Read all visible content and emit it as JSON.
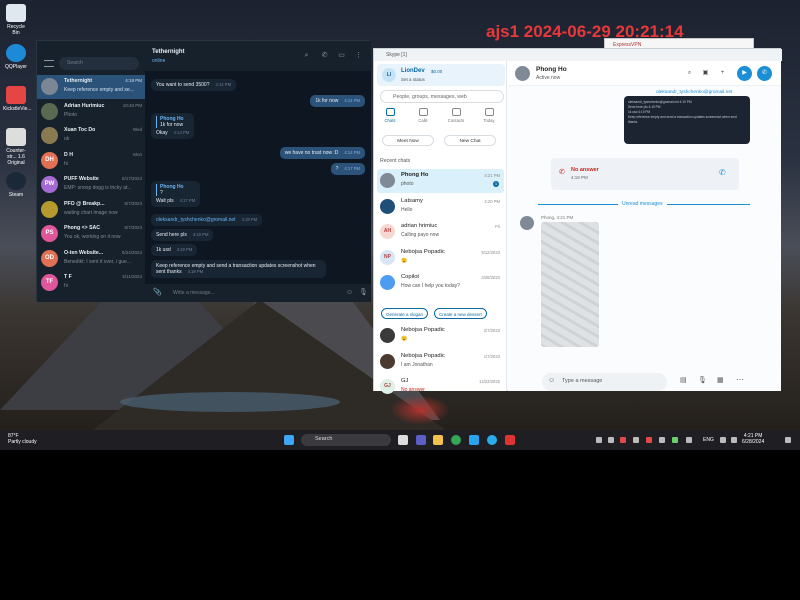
{
  "overlay_title": "ajs1 2024-06-29 20:21:14",
  "desktop_icons": [
    "Recycle Bin",
    "QQPlayer",
    "KickstleVie...",
    "Counter-str... 1.6 Original",
    "Steam"
  ],
  "telegram": {
    "search_placeholder": "Search",
    "chats": [
      {
        "initials": "",
        "name": "Tethernight",
        "time": "4:19 PM",
        "preview": "Keep reference empty and se...",
        "color": "#7b8794"
      },
      {
        "initials": "",
        "name": "Adrian Hurimiuc",
        "time": "10:40 PM",
        "preview": "Photo",
        "color": "#5a6a52"
      },
      {
        "initials": "",
        "name": "Xuan Toc Do",
        "time": "Wed",
        "preview": "ok",
        "color": "#8a7a50"
      },
      {
        "initials": "DH",
        "name": "D H",
        "time": "Mon",
        "preview": "hi",
        "color": "#e17055"
      },
      {
        "initials": "PW",
        "name": "PUFF Website",
        "time": "6/17/2024",
        "preview": "EMP: snoop dogg is tricky at...",
        "color": "#a66bd3"
      },
      {
        "initials": "",
        "name": "PFO @ Breakp...",
        "time": "6/7/2024",
        "preview": "waiting chart image now",
        "color": "#b59a2d"
      },
      {
        "initials": "PS",
        "name": "Phong <> SAC",
        "time": "6/7/2024",
        "preview": "You ok, working on it now",
        "color": "#e0569a"
      },
      {
        "initials": "OD",
        "name": "O-ten Website...",
        "time": "5/24/2024",
        "preview": "Benedikt: I sent it over, i gue...",
        "color": "#e17055"
      },
      {
        "initials": "TF",
        "name": "T F",
        "time": "5/11/2024",
        "preview": "hi",
        "color": "#e0569a"
      }
    ],
    "header": {
      "name": "Tethernight",
      "status": "online"
    },
    "messages": [
      {
        "dir": "in",
        "quote": "",
        "quote_text": "",
        "text": "You want to send 3500?",
        "time": "4:14 PM"
      },
      {
        "dir": "out",
        "quote": "",
        "quote_text": "",
        "text": "1k for now",
        "time": "4:14 PM"
      },
      {
        "dir": "in",
        "quote": "Phong Ho",
        "quote_text": "1k for now",
        "text": "Okay",
        "time": "4:14 PM"
      },
      {
        "dir": "out",
        "quote": "",
        "quote_text": "",
        "text": "we have no trust now :D",
        "time": "4:14 PM"
      },
      {
        "dir": "out",
        "quote": "",
        "quote_text": "",
        "text": "?",
        "time": "4:17 PM"
      },
      {
        "dir": "in",
        "quote": "Phong Ho",
        "quote_text": "?",
        "text": "Wait pls",
        "time": "4:17 PM"
      },
      {
        "dir": "in",
        "quote": "",
        "quote_text": "",
        "text": "oleksandr_tyshchenko@gromail.net",
        "time": "4:19 PM"
      },
      {
        "dir": "in",
        "quote": "",
        "quote_text": "",
        "text": "Send here pls",
        "time": "4:19 PM"
      },
      {
        "dir": "in",
        "quote": "",
        "quote_text": "",
        "text": "1k usd",
        "time": "4:19 PM"
      },
      {
        "dir": "in",
        "quote": "",
        "quote_text": "",
        "text": "Keep reference empty and send a transaction updates screenshot when sent thanks",
        "time": "4:19 PM"
      }
    ],
    "input_placeholder": "Write a message..."
  },
  "skype": {
    "title": "Skype [1]",
    "profile": {
      "initials": "LI",
      "name": "LionDev",
      "balance": "$0.00",
      "status": "Set a status"
    },
    "search_placeholder": "People, groups, messages, web",
    "nav": [
      {
        "label": "Chats",
        "badge": "1"
      },
      {
        "label": "Calls",
        "badge": ""
      },
      {
        "label": "Contacts",
        "badge": ""
      },
      {
        "label": "Today",
        "badge": ""
      }
    ],
    "meet_now": "Meet Now",
    "new_chat": "New Chat",
    "recent_label": "Recent chats",
    "chats": [
      {
        "initials": "",
        "name": "Phong Ho",
        "time": "4:21 PM",
        "preview": "photo",
        "badge": "1",
        "color": "#7f8a96"
      },
      {
        "initials": "",
        "name": "Latsamy",
        "time": "4:20 PM",
        "preview": "Hello",
        "badge": "",
        "color": "#1f4e79"
      },
      {
        "initials": "AH",
        "name": "adrian hrimiuc",
        "time": "Fri",
        "preview": "Calling payo now",
        "badge": "",
        "color": "#f6d7d2"
      },
      {
        "initials": "NP",
        "name": "Nebojsa Popadic",
        "time": "5/12/2023",
        "preview": "😉",
        "badge": "",
        "color": "#d6e6f5"
      },
      {
        "initials": "",
        "name": "Copilot",
        "time": "3/28/2023",
        "preview": "How can I help you today?",
        "badge": "",
        "color": "#4e9cf0"
      },
      {
        "initials": "",
        "name": "Nebojsa Popadic",
        "time": "2/7/2023",
        "preview": "😉",
        "badge": "",
        "color": "#3a3a3a"
      },
      {
        "initials": "",
        "name": "Nebojsa Popadic",
        "time": "1/7/2023",
        "preview": "I am Jonathan",
        "badge": "",
        "color": "#4a3a30"
      },
      {
        "initials": "GJ",
        "name": "GJ",
        "time": "12/22/2022",
        "preview": "No answer",
        "badge": "",
        "color": "#dff0e8"
      }
    ],
    "copilot_chips": [
      "Generate a slogan",
      "Create a new dessert"
    ],
    "conversation": {
      "name": "Phong Ho",
      "status": "Active now",
      "link_email": "oleksandr_tyshchenko@gromail.net",
      "thumb_lines": [
        "oleksandr_tyshchenko@gromail.net  4:19 PM",
        "Send here pls  4:19 PM",
        "1k usd  4:19 PM",
        "Keep reference empty and send a transaction updates screenshot when sent thanks"
      ],
      "missed_title": "No answer",
      "missed_time": "4:19 PM",
      "unread": "Unread messages",
      "sender": "Phong, 4:21 PM",
      "input_placeholder": "Type a message"
    }
  },
  "vpn_title": "ExpressVPN",
  "taskbar": {
    "weather_temp": "87°F",
    "weather_desc": "Partly cloudy",
    "search": "Search",
    "lang": "ENG",
    "time": "4:21 PM",
    "date": "6/28/2024"
  }
}
